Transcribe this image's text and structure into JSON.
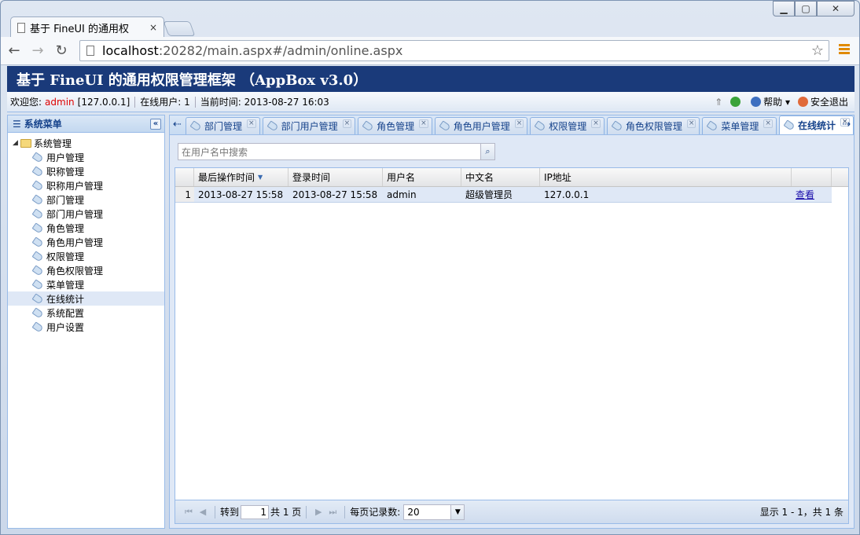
{
  "browser": {
    "tab_title": "基于 FineUI 的通用权",
    "tab_close": "×",
    "url_host": "localhost",
    "url_rest": ":20282/main.aspx#/admin/online.aspx"
  },
  "app": {
    "title": "基于 FineUI 的通用权限管理框架 （AppBox v3.0）",
    "welcome_label": "欢迎您:",
    "user": "admin",
    "ip": "[127.0.0.1]",
    "online_label": "在线用户:",
    "online_count": "1",
    "time_label": "当前时间:",
    "time_value": "2013-08-27 16:03",
    "help_label": "帮助",
    "logout_label": "安全退出"
  },
  "sidebar": {
    "title": "系统菜单",
    "root": "系统管理",
    "items": [
      "用户管理",
      "职称管理",
      "职称用户管理",
      "部门管理",
      "部门用户管理",
      "角色管理",
      "角色用户管理",
      "权限管理",
      "角色权限管理",
      "菜单管理",
      "在线统计",
      "系统配置",
      "用户设置"
    ],
    "selected_index": 10
  },
  "tabs": [
    "部门管理",
    "部门用户管理",
    "角色管理",
    "角色用户管理",
    "权限管理",
    "角色权限管理",
    "菜单管理",
    "在线统计"
  ],
  "active_tab": 7,
  "search": {
    "placeholder": "在用户名中搜索"
  },
  "grid": {
    "columns": [
      "最后操作时间",
      "登录时间",
      "用户名",
      "中文名",
      "IP地址",
      ""
    ],
    "rows": [
      {
        "num": "1",
        "last_op": "2013-08-27 15:58",
        "login": "2013-08-27 15:58",
        "username": "admin",
        "chinese_name": "超级管理员",
        "ip": "127.0.0.1",
        "action": "查看"
      }
    ]
  },
  "pager": {
    "goto_label": "转到",
    "page_value": "1",
    "total_pages": "共 1 页",
    "page_size_label": "每页记录数:",
    "page_size": "20",
    "summary": "显示 1 - 1，共 1 条"
  }
}
